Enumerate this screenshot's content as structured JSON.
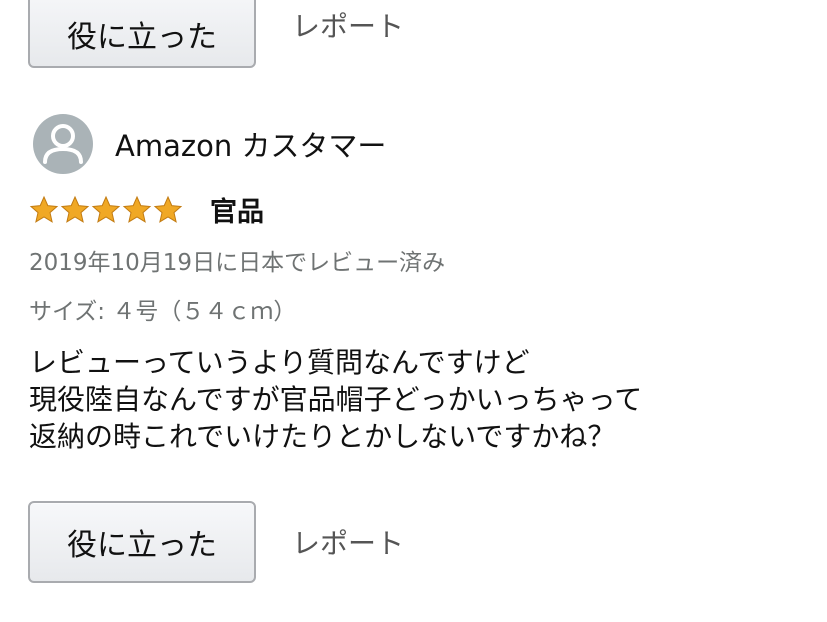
{
  "top_actions": {
    "helpful_label": "役に立った",
    "report_label": "レポート"
  },
  "review": {
    "reviewer_name": "Amazon カスタマー",
    "avatar_icon": "person-silhouette-icon",
    "rating": 5,
    "rating_max": 5,
    "star_color": "#f0a825",
    "title": "官品",
    "date_text": "2019年10月19日に日本でレビュー済み",
    "variant_text": "サイズ: ４号（５４ｃｍ）",
    "body_lines": [
      "レビューっていうより質問なんですけど",
      "現役陸自なんですが官品帽子どっかいっちゃって",
      "返納の時これでいけたりとかしないですかね？"
    ]
  },
  "bottom_actions": {
    "helpful_label": "役に立った",
    "report_label": "レポート"
  }
}
